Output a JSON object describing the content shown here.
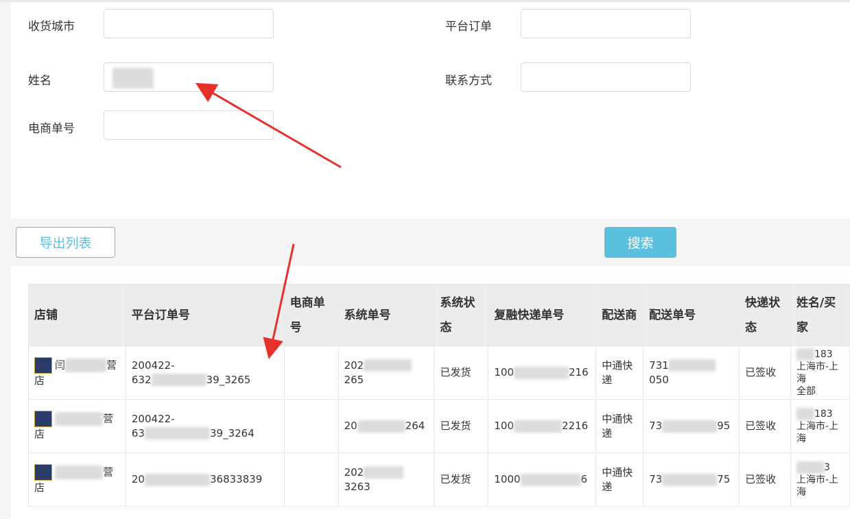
{
  "form": {
    "city_label": "收货城市",
    "platform_order_label": "平台订单",
    "name_label": "姓名",
    "contact_label": "联系方式",
    "ecommerce_no_label": "电商单号"
  },
  "buttons": {
    "export": "导出列表",
    "search": "搜索"
  },
  "table": {
    "headers": [
      "店铺",
      "平台订单号",
      "电商单号",
      "系统单号",
      "系统状态",
      "复融快递单号",
      "配送商",
      "配送单号",
      "快递状态",
      "姓名/买家"
    ],
    "rows": [
      {
        "shop_a": "闫",
        "shop_b": "营",
        "shop_c": "店",
        "order_a": "200422-",
        "order_b": "632",
        "order_c": "39_3265",
        "system_a": "202",
        "system_b": "265",
        "status": "已发货",
        "fr_a": "100",
        "fr_b": "216",
        "carrier": "中通快递",
        "delivery_a": "731",
        "delivery_b": "050",
        "express_status": "已签收",
        "buyer_a": "183",
        "buyer_b": "上海市-上海",
        "buyer_c": "全部"
      },
      {
        "shop_a": "",
        "shop_b": "营",
        "shop_c": "店",
        "order_a": "200422-",
        "order_b": "63",
        "order_c": "39_3264",
        "system_a": "20",
        "system_b": "264",
        "status": "已发货",
        "fr_a": "100",
        "fr_b": "2216",
        "carrier": "中通快递",
        "delivery_a": "73",
        "delivery_b": "95",
        "express_status": "已签收",
        "buyer_a": "183",
        "buyer_b": "上海市-上海",
        "buyer_c": ""
      },
      {
        "shop_a": "",
        "shop_b": "营",
        "shop_c": "店",
        "order_a": "20",
        "order_b": "",
        "order_c": "36833839",
        "system_a": "202",
        "system_b": "3263",
        "status": "已发货",
        "fr_a": "1000",
        "fr_b": "6",
        "carrier": "中通快递",
        "delivery_a": "73",
        "delivery_b": "75",
        "express_status": "已签收",
        "buyer_a": "3",
        "buyer_b": "上海市-上海",
        "buyer_c": ""
      }
    ]
  },
  "colors": {
    "accent": "#5bc0de",
    "arrow": "#e8302a"
  }
}
